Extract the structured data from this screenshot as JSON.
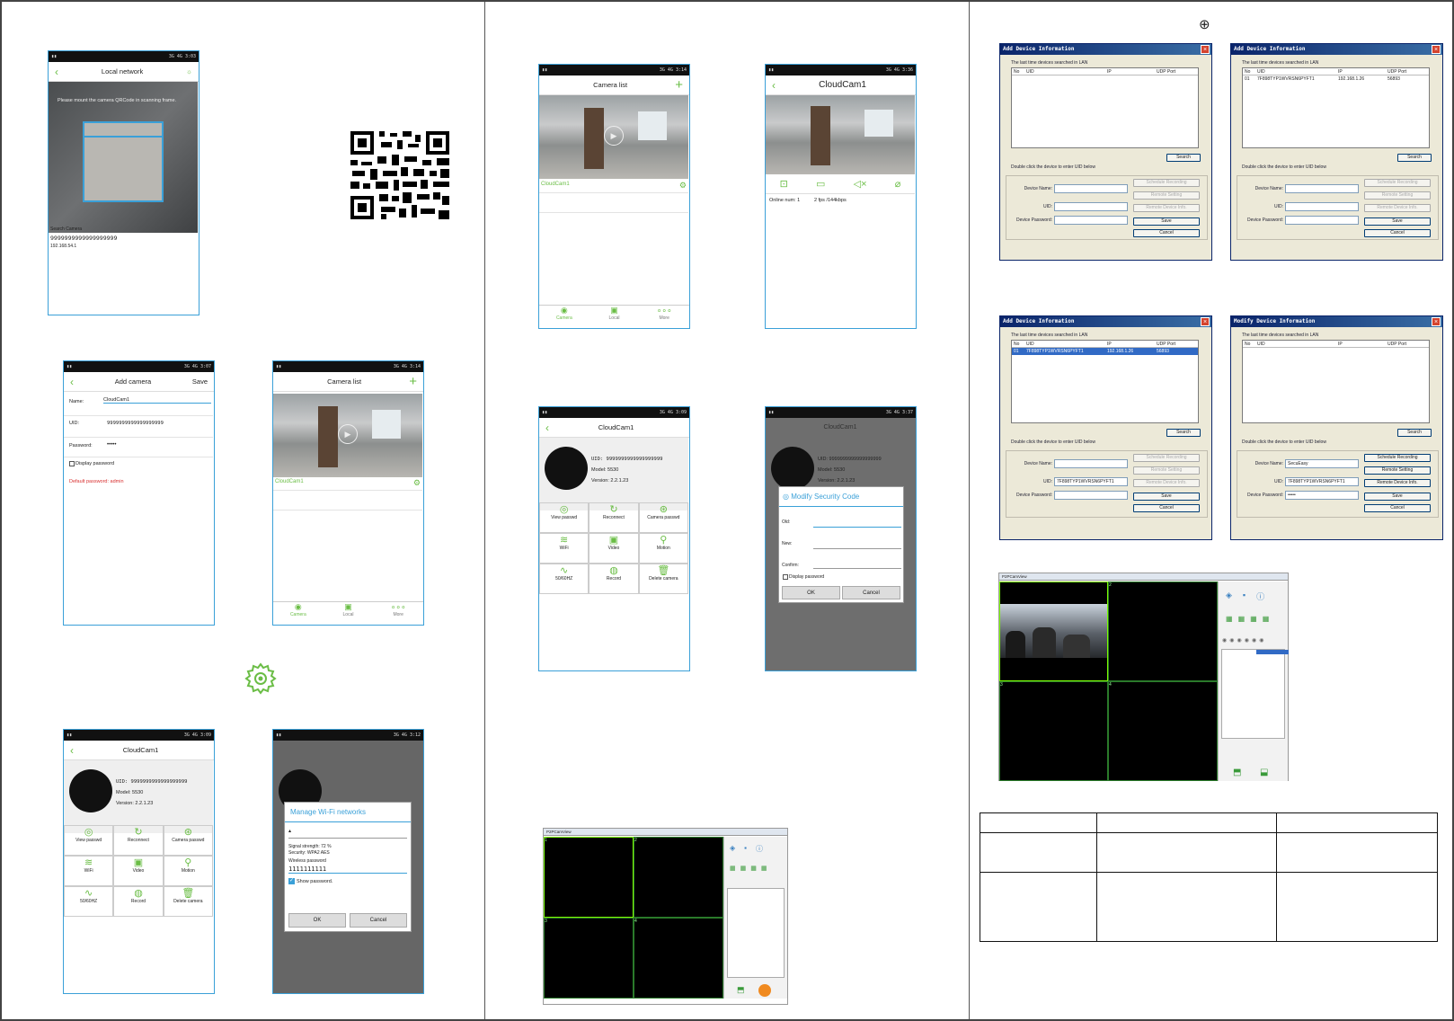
{
  "colors": {
    "accent": "#6abd45",
    "frame": "#3aa0d8",
    "win_title": "#0a246a",
    "win_select": "#316ac5",
    "alert": "#d83030"
  },
  "top_symbol": "⊕",
  "panel1": {
    "local_network": {
      "status": "3G 4G 3:03",
      "title": "Local network",
      "hint": "Please mount the camera QRCode in scanning frame.",
      "search_label": "Search Camera",
      "uid": "9999999999999999999",
      "ip": "192.168.54.1"
    },
    "add_camera": {
      "status": "3G 4G 3:07",
      "title": "Add camera",
      "save": "Save",
      "name_label": "Name:",
      "name_value": "CloudCam1",
      "uid_label": "UID:",
      "uid_value": "9999999999999999999",
      "password_label": "Password:",
      "password_value": "•••••",
      "display_password": "Display password",
      "default_password": "Default password: admin"
    },
    "camera_list_a": {
      "status": "3G 4G 3:14",
      "title": "Camera list",
      "camera_name": "CloudCam1",
      "tabs": [
        "Camera",
        "Local",
        "More"
      ]
    },
    "settings_a": {
      "status": "3G 4G 3:09",
      "title": "CloudCam1",
      "uid_line": "UID: 9999999999999999999",
      "model_line": "Model: 5530",
      "version_line": "Version: 2.2.1.23",
      "actions": [
        "View passwd",
        "Reconnect",
        "Camera passwd",
        "WiFi",
        "Video",
        "Motion",
        "50/60HZ",
        "Record",
        "Delete camera"
      ]
    },
    "wifi_dialog": {
      "status": "3G 4G 3:12",
      "title": "Manage Wi-Fi networks",
      "signal": "Signal strength: 72 %",
      "security": "Security: WPA2 AES",
      "pw_label": "Wireless password",
      "pw_value": "1111111111",
      "show_password": "Show password.",
      "ok": "OK",
      "cancel": "Cancel"
    }
  },
  "panel2": {
    "camera_list_b": {
      "status": "3G 4G 3:14",
      "title": "Camera list",
      "camera_name": "CloudCam1",
      "tabs": [
        "Camera",
        "Local",
        "More"
      ]
    },
    "live": {
      "status": "3G 4G 3:36",
      "title": "CloudCam1",
      "online": "Online num: 1",
      "rate": "2 fps /144kbps"
    },
    "settings_b": {
      "status": "3G 4G 3:09",
      "title": "CloudCam1",
      "uid_line": "UID: 9999999999999999999",
      "model_line": "Model: 5530",
      "version_line": "Version: 2.2.1.23",
      "actions": [
        "View passwd",
        "Reconnect",
        "Camera passwd",
        "WiFi",
        "Video",
        "Motion",
        "50/60HZ",
        "Record",
        "Delete camera"
      ]
    },
    "security_dialog": {
      "status": "3G 4G 3:37",
      "bg_title": "CloudCam1",
      "bg_uid": "UID: 9999999999999999999",
      "bg_model": "Model: 5530",
      "bg_version": "Version: 2.2.1.23",
      "title": "Modify Security Code",
      "old": "Old:",
      "new": "New:",
      "confirm": "Confirm:",
      "display_password": "Display password",
      "ok": "OK",
      "cancel": "Cancel"
    }
  },
  "panel3": {
    "dialogs": [
      {
        "title": "Add Device Information",
        "caption": "The last time devices searched in LAN",
        "cols": [
          "No",
          "UID",
          "IP",
          "UDP Port"
        ],
        "rows": [],
        "selected": false,
        "search": "Search",
        "hint": "Double click the device to enter UID below",
        "name_label": "Device Name:",
        "name_value": "",
        "uid_label": "UID:",
        "uid_value": "",
        "pw_label": "Device Password:",
        "pw_value": "",
        "b1": "Schedule Recording",
        "b2": "Remote Setting",
        "b3": "Remote Device Info.",
        "save": "Save",
        "cancel": "Cancel",
        "enabled": false
      },
      {
        "title": "Add Device Information",
        "caption": "The last time devices searched in LAN",
        "cols": [
          "No",
          "UID",
          "IP",
          "UDP Port"
        ],
        "rows": [
          [
            "01",
            "7F898TYP1WVRSN6PYFT1",
            "192.168.1.26",
            "56893"
          ]
        ],
        "selected": false,
        "search": "Search",
        "hint": "Double click the device to enter UID below",
        "name_label": "Device Name:",
        "name_value": "",
        "uid_label": "UID:",
        "uid_value": "",
        "pw_label": "Device Password:",
        "pw_value": "",
        "b1": "Schedule Recording",
        "b2": "Remote Setting",
        "b3": "Remote Device Info.",
        "save": "Save",
        "cancel": "Cancel",
        "enabled": false
      },
      {
        "title": "Add Device Information",
        "caption": "The last time devices searched in LAN",
        "cols": [
          "No",
          "UID",
          "IP",
          "UDP Port"
        ],
        "rows": [
          [
            "01",
            "7F898TYP1WVRSN6PYFT1",
            "192.168.1.26",
            "56893"
          ]
        ],
        "selected": true,
        "search": "Search",
        "hint": "Double click the device to enter UID below",
        "name_label": "Device Name:",
        "name_value": "",
        "uid_label": "UID:",
        "uid_value": "7F898TYP1WVRSN6PYFT1",
        "pw_label": "Device Password:",
        "pw_value": "",
        "b1": "Schedule Recording",
        "b2": "Remote Setting",
        "b3": "Remote Device Info.",
        "save": "Save",
        "cancel": "Cancel",
        "enabled": false
      },
      {
        "title": "Modify Device Information",
        "caption": "The last time devices searched in LAN",
        "cols": [
          "No",
          "UID",
          "IP",
          "UDP Port"
        ],
        "rows": [],
        "selected": false,
        "search": "Search",
        "hint": "Double click the device to enter UID below",
        "name_label": "Device Name:",
        "name_value": "SecuEasy",
        "uid_label": "UID:",
        "uid_value": "7F898TYP1WVRSN6PYFT1",
        "pw_label": "Device Password:",
        "pw_value": "•••••",
        "b1": "Schedule Recording",
        "b2": "Remote Setting",
        "b3": "Remote Device Info.",
        "save": "Save",
        "cancel": "Cancel",
        "enabled": true
      }
    ],
    "cms_title": "P2PCamView",
    "table": {
      "rows": 3,
      "cols": 3
    }
  }
}
